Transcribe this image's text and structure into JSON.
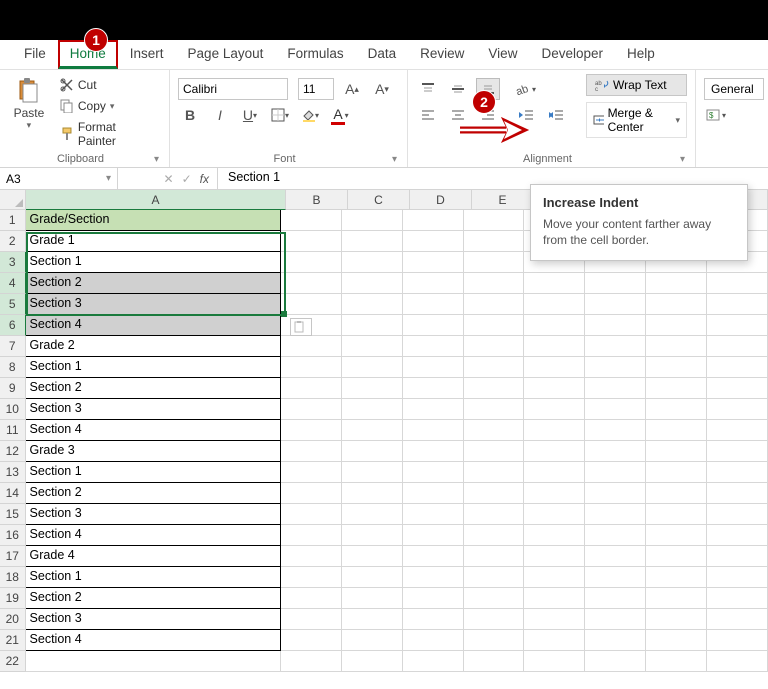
{
  "annotations": {
    "badge1": "1",
    "badge2": "2"
  },
  "tabs": {
    "file": "File",
    "home": "Home",
    "insert": "Insert",
    "pagelayout": "Page Layout",
    "formulas": "Formulas",
    "data": "Data",
    "review": "Review",
    "view": "View",
    "developer": "Developer",
    "help": "Help"
  },
  "ribbon": {
    "clipboard": {
      "paste": "Paste",
      "cut": "Cut",
      "copy": "Copy",
      "formatpainter": "Format Painter",
      "label": "Clipboard"
    },
    "font": {
      "name": "Calibri",
      "size": "11",
      "label": "Font"
    },
    "alignment": {
      "wrap": "Wrap Text",
      "merge": "Merge & Center",
      "label": "Alignment"
    },
    "number": {
      "format": "General"
    }
  },
  "tooltip": {
    "title": "Increase Indent",
    "body": "Move your content farther away from the cell border."
  },
  "namebox": "A3",
  "formula": "Section 1",
  "columns": [
    "A",
    "B",
    "C",
    "D",
    "E"
  ],
  "rows": [
    "Grade/Section",
    "Grade 1",
    "Section 1",
    "Section 2",
    "Section 3",
    "Section 4",
    "Grade 2",
    "Section 1",
    "Section 2",
    "Section 3",
    "Section 4",
    "Grade 3",
    "Section 1",
    "Section 2",
    "Section 3",
    "Section 4",
    "Grade 4",
    "Section 1",
    "Section 2",
    "Section 3",
    "Section 4",
    ""
  ]
}
